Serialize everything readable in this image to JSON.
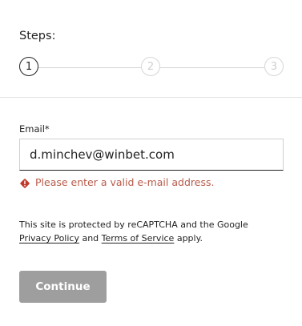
{
  "steps": {
    "title": "Steps:",
    "items": [
      {
        "number": "1",
        "state": "active"
      },
      {
        "number": "2",
        "state": "inactive"
      },
      {
        "number": "3",
        "state": "inactive"
      }
    ]
  },
  "email": {
    "label": "Email*",
    "value": "d.minchev@winbet.com",
    "error": "Please enter a valid e-mail address."
  },
  "recaptcha": {
    "prefix": "This site is protected by reCAPTCHA and the Google",
    "privacy_link": "Privacy Policy",
    "and_text": "and",
    "terms_link": "Terms of Service",
    "suffix": "apply."
  },
  "continue_button": {
    "label": "Continue",
    "disabled": true
  },
  "colors": {
    "error": "#b85a4a",
    "error_icon": "#c0392b",
    "button_disabled": "#9e9e9e",
    "step_active": "#222222",
    "step_inactive": "#d6d6d6"
  },
  "icons": {
    "error": "warning-diamond-icon"
  }
}
